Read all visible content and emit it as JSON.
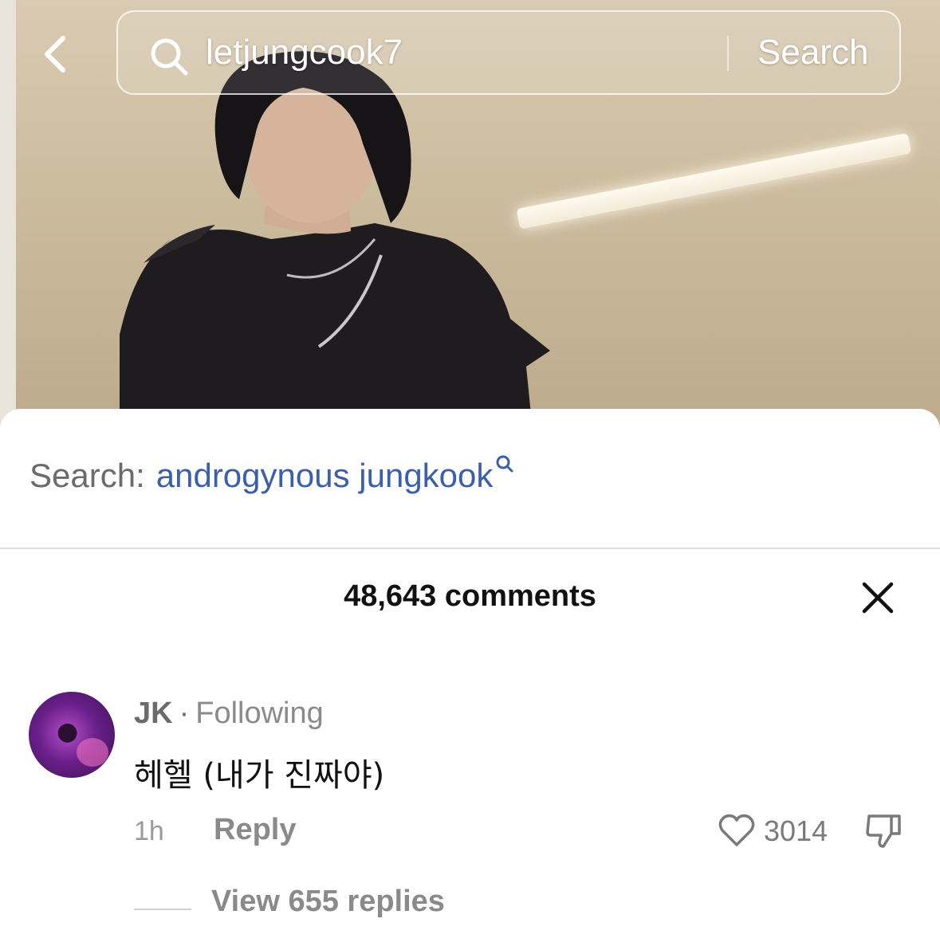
{
  "search": {
    "query": "letjungcook7",
    "button_label": "Search"
  },
  "suggestion": {
    "label": "Search:",
    "term": "androgynous jungkook"
  },
  "comments": {
    "count_label": "48,643 comments"
  },
  "comment": {
    "author": "JK",
    "separator": "·",
    "status": "Following",
    "text": "헤헬 (내가 진짜야)",
    "time": "1h",
    "reply_label": "Reply",
    "likes": "3014",
    "view_replies": "View 655 replies"
  },
  "colors": {
    "link_blue": "#3b5fa8",
    "muted_gray": "#8a8a8a"
  },
  "icons": [
    "chevron-left-icon",
    "search-icon",
    "search-small-icon",
    "close-icon",
    "heart-icon",
    "thumbs-down-icon"
  ]
}
